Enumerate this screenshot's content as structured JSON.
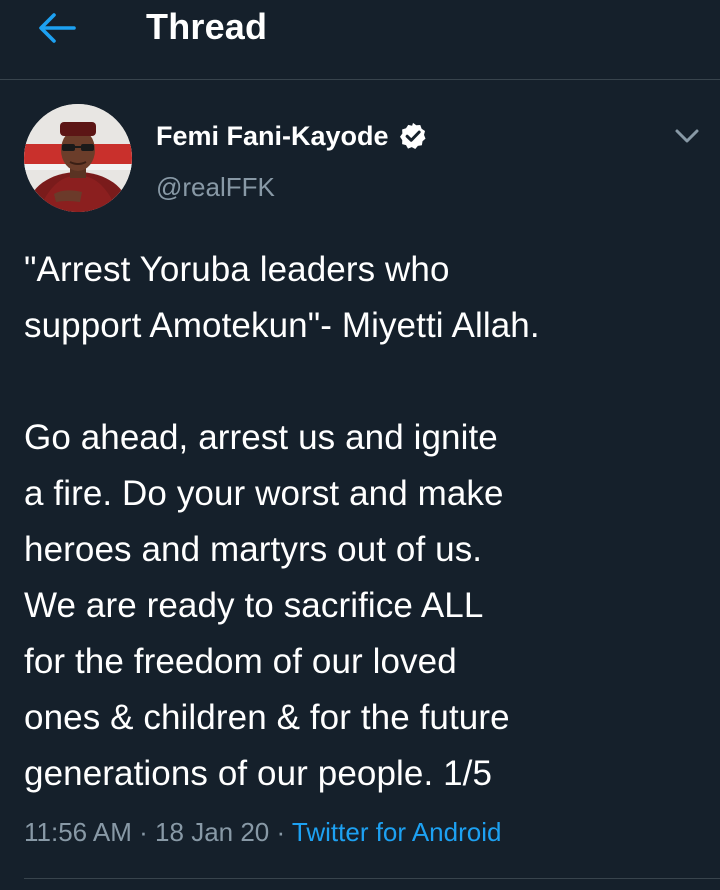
{
  "header": {
    "title": "Thread",
    "back_icon": "arrow-left-icon",
    "accent_color": "#1da1f2"
  },
  "tweet": {
    "author": {
      "display_name": "Femi Fani-Kayode",
      "handle": "@realFFK",
      "verified": true,
      "verified_icon": "verified-badge-icon"
    },
    "menu_icon": "chevron-down-icon",
    "text_paragraph_1": "\"Arrest Yoruba leaders who\nsupport Amotekun\"- Miyetti Allah.",
    "text_paragraph_2": "Go ahead, arrest us and ignite\na fire. Do your worst and make\nheroes and martyrs out of us.\nWe are ready to sacrifice ALL\nfor the freedom of our loved\nones & children & for the future\ngenerations of our people. 1/5",
    "time": "11:56 AM",
    "separator": " · ",
    "date": "18 Jan 20",
    "source": "Twitter for Android"
  },
  "colors": {
    "background": "#15202b",
    "text_primary": "#ffffff",
    "text_secondary": "#8899a6",
    "divider": "#38444d",
    "link": "#1da1f2"
  }
}
